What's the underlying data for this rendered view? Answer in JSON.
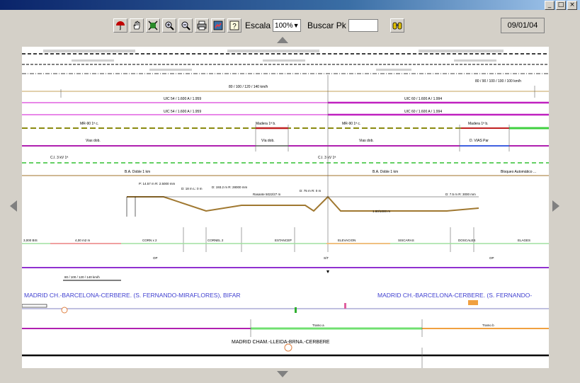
{
  "toolbar": {
    "tools": [
      {
        "name": "umbrella-icon"
      },
      {
        "name": "hand-icon"
      },
      {
        "name": "zoom-fit-icon"
      },
      {
        "name": "zoom-in-icon"
      },
      {
        "name": "zoom-out-icon"
      },
      {
        "name": "print-icon"
      },
      {
        "name": "export-icon"
      },
      {
        "name": "help-icon"
      }
    ],
    "scale_label": "Escala",
    "scale_value": "100%",
    "search_label": "Buscar Pk",
    "search_value": "",
    "date": "09/01/04"
  },
  "window": {
    "minimize": "_",
    "maximize": "□",
    "close": "×"
  },
  "diagram": {
    "route_blue_left": "MADRID CH.-BARCELONA-CERBERE. (S. FERNANDO-MIRAFLORES), BIFAR",
    "route_blue_right": "MADRID CH.-BARCELONA-CERBERE. (S. FERNANDO-",
    "route_black": "MADRID CHAM.-LLEIDA-BRNA.-CERBERE",
    "speed_top": "80 / 100 / 120 / 140 km/h",
    "speed_top_right": "80 / 90 / 100 / 100 / 100 km/h",
    "rail_left_1": "UIC 54 / 1.600 A / 1.959",
    "rail_right_1": "UIC 60 / 1.600 A / 1.994",
    "rail_left_2": "UIC 54 / 1.600 A / 1.959",
    "rail_right_2": "UIC 60 / 1.600 A / 1.994",
    "sleeper_left": "MR-90 1ª c.",
    "sleeper_mid": "Madera 1ª b.",
    "sleeper_right": "MR-90 1ª c.",
    "sleeper_far": "Madera 1ª b.",
    "ballast_left": "Vias dob.",
    "ballast_mid": "Vía dob.",
    "ballast_right": "Vias dob.",
    "ballast_far": "D. VIAS Par",
    "catenary_left": "C.I. 3 kV 1ª",
    "catenary_right": "C.I. 3 kV 1ª",
    "signal_left": "B.A. Doble 1 km",
    "signal_right": "B.A. Doble 1 km",
    "signal_far": "Bloqueo Automático ...",
    "profile_note_1": "P: 14.57 m\nR: 2.5000 mm",
    "profile_note_2": "D: 18 m\nL: 0 m",
    "profile_note_3": "D: 193.2 m\nR: 28000 mm",
    "profile_note_4": "Rasante\n5022/27 m",
    "profile_note_5": "D: 75 m\nR: 0 m",
    "profile_note_6": "D: 7.5 m\nR: 3000 mm",
    "profile_grade": "1.80/1000 m",
    "stations_left": "3,000 BIS",
    "stations_1": "4,00 m2 m",
    "stations_2": "CORN x 2",
    "stations_3": "CORNEL 2",
    "stations_4": "ESTANCEP",
    "stations_5": "ELEVACION",
    "stations_6": "SISCARAS",
    "stations_7": "DOSCALES",
    "stations_8": "ELAGES",
    "op_left": "OP",
    "op_mid": "S/T",
    "op_right": "OP",
    "speed_bottom": "80 / 100 / 120 / 140 km/h",
    "section_mid": "Tramo a",
    "section_right": "Tramo b"
  }
}
